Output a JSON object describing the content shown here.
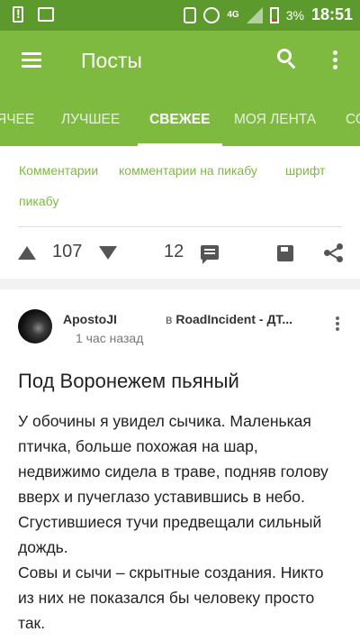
{
  "status_bar": {
    "network": "4G",
    "battery": "3%",
    "time": "18:51",
    "icons": [
      "alert-icon",
      "image-icon",
      "vibrate-icon",
      "alarm-icon",
      "signal-icon",
      "battery-icon"
    ]
  },
  "app_bar": {
    "title": "Посты",
    "icons": [
      "menu-icon",
      "search-icon",
      "more-vert-icon"
    ]
  },
  "tabs": {
    "items": [
      {
        "label": "ЯЧЕЕ"
      },
      {
        "label": "ЛУЧШЕЕ"
      },
      {
        "label": "СВЕЖЕЕ"
      },
      {
        "label": "МОЯ ЛЕНТА"
      },
      {
        "label": "СО"
      }
    ],
    "active": "СВЕЖЕЕ"
  },
  "prev_post": {
    "tags": [
      "Комментарии",
      "комментарии на пикабу",
      "шрифт",
      "пикабу"
    ],
    "score": "107",
    "comments_count": "12"
  },
  "post": {
    "author": "ApostoJI",
    "time_ago": "1 час назад",
    "community_prefix": "в",
    "community": "RoadIncident - ДТ...",
    "title": "Под Воронежем пьяный",
    "body": [
      "У обочины я увидел сычика. Маленькая птичка, больше похожая на шар, недвижимо сидела в траве, подняв голову вверх и пучеглазо уставившись в небо. Сгустившиеся тучи предвещали сильный дождь.",
      "Совы и сычи – скрытные создания. Никто из них не показался бы человеку просто так."
    ]
  },
  "colors": {
    "status_bar": "#5c9a2e",
    "app_bar": "#7dba3f",
    "accent": "#7dba3f",
    "background": "#f2f2f2"
  }
}
